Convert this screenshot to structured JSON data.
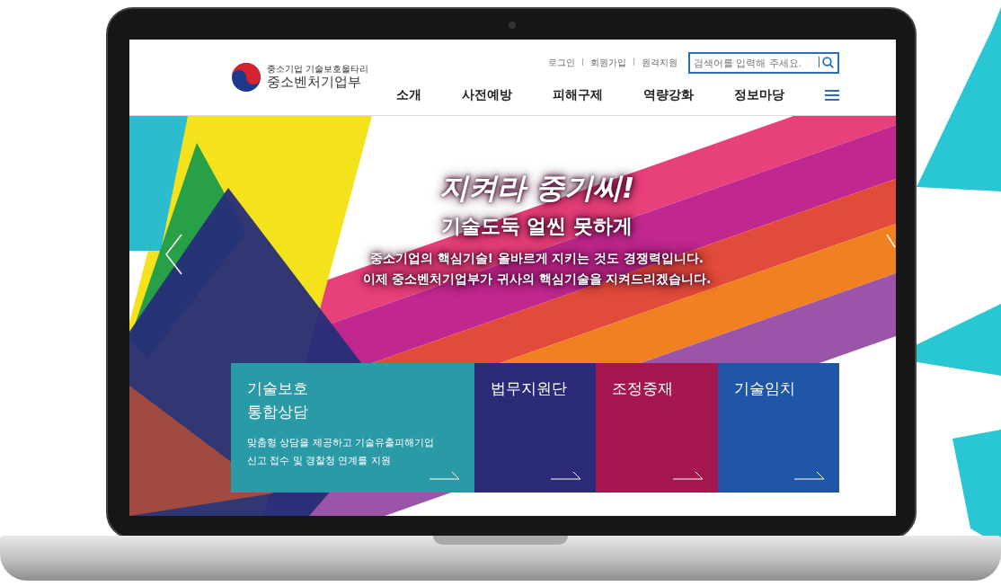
{
  "header": {
    "logo_caption": "중소기업 기술보호울타리",
    "logo_title": "중소벤처기업부",
    "utility_links": [
      "로그인",
      "회원가입",
      "원격지원"
    ],
    "search": {
      "placeholder": "검색어를 입력해 주세요."
    },
    "nav": [
      "소개",
      "사전예방",
      "피해구제",
      "역량강화",
      "정보마당"
    ]
  },
  "banner": {
    "title": "지켜라 중기씨!",
    "subtitle": "기술도둑 얼씬 못하게",
    "lines": [
      "중소기업의 핵심기술! 올바르게 지키는 것도 경쟁력입니다.",
      "이제 중소벤처기업부가 귀사의 핵심기술을 지켜드리겠습니다."
    ]
  },
  "cards": [
    {
      "title_lines": [
        "기술보호",
        "통합상담"
      ],
      "description_lines": [
        "맞춤형 상담을 제공하고 기술유출피해기업",
        "신고 접수 및 경찰청 연계를 지원"
      ],
      "color": "#2a9aa6"
    },
    {
      "title_lines": [
        "법무지원단"
      ],
      "color": "#2b2a78"
    },
    {
      "title_lines": [
        "조정중재"
      ],
      "color": "#a3174e"
    },
    {
      "title_lines": [
        "기술임치"
      ],
      "color": "#1f56a8"
    }
  ]
}
